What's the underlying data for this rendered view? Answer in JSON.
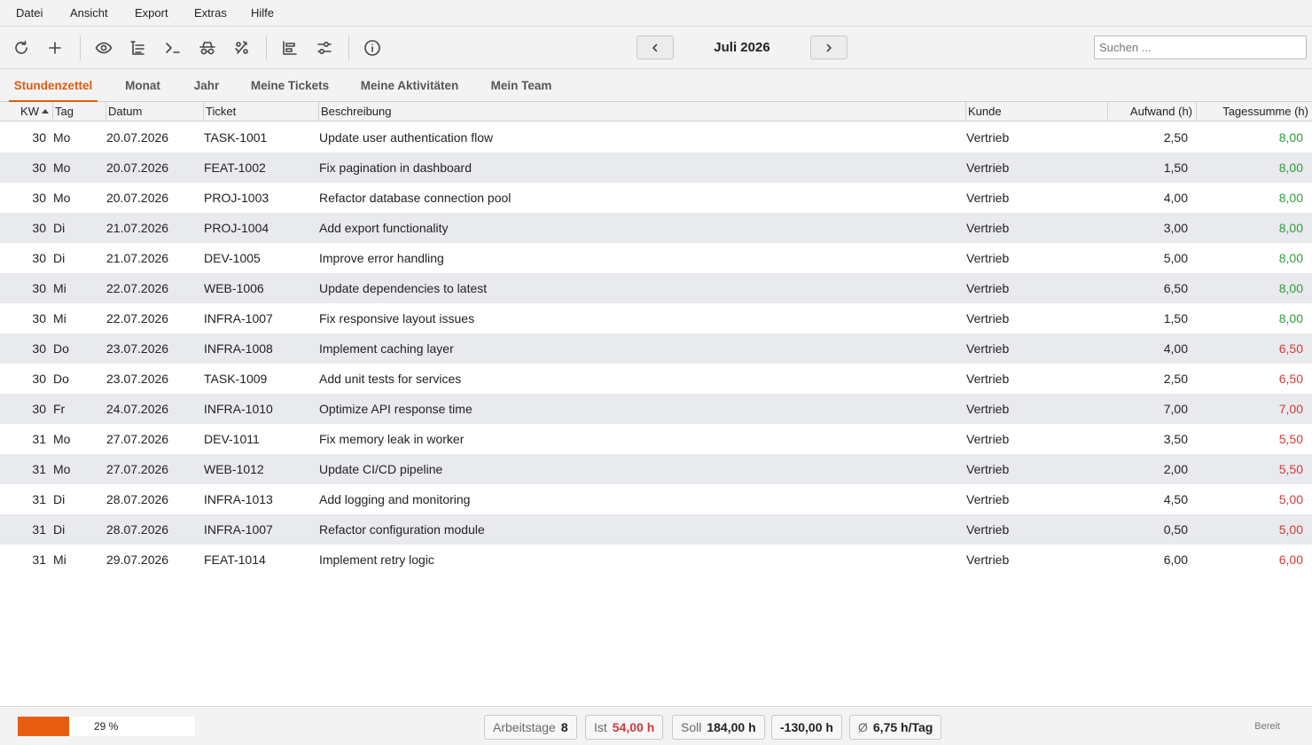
{
  "menu": [
    "Datei",
    "Ansicht",
    "Export",
    "Extras",
    "Hilfe"
  ],
  "toolbar": {
    "icons": [
      "refresh-icon",
      "plus-icon",
      "eye-icon",
      "list-icon",
      "terminal-icon",
      "incognito-icon",
      "percent-icon",
      "align-left-icon",
      "sliders-icon",
      "info-icon"
    ],
    "period": "Juli 2026",
    "search_placeholder": "Suchen ..."
  },
  "tabs": [
    {
      "label": "Stundenzettel",
      "active": true
    },
    {
      "label": "Monat",
      "active": false
    },
    {
      "label": "Jahr",
      "active": false
    },
    {
      "label": "Meine Tickets",
      "active": false
    },
    {
      "label": "Meine Aktivitäten",
      "active": false
    },
    {
      "label": "Mein Team",
      "active": false
    }
  ],
  "columns": [
    "KW",
    "Tag",
    "Datum",
    "Ticket",
    "Beschreibung",
    "Kunde",
    "Aufwand (h)",
    "Tagessumme (h)"
  ],
  "rows": [
    {
      "kw": "30",
      "tag": "Mo",
      "datum": "20.07.2026",
      "ticket": "TASK-1001",
      "beschreibung": "Update user authentication flow",
      "kunde": "Vertrieb",
      "aufwand": "2,50",
      "summe": "8,00",
      "ok": true
    },
    {
      "kw": "30",
      "tag": "Mo",
      "datum": "20.07.2026",
      "ticket": "FEAT-1002",
      "beschreibung": "Fix pagination in dashboard",
      "kunde": "Vertrieb",
      "aufwand": "1,50",
      "summe": "8,00",
      "ok": true
    },
    {
      "kw": "30",
      "tag": "Mo",
      "datum": "20.07.2026",
      "ticket": "PROJ-1003",
      "beschreibung": "Refactor database connection pool",
      "kunde": "Vertrieb",
      "aufwand": "4,00",
      "summe": "8,00",
      "ok": true
    },
    {
      "kw": "30",
      "tag": "Di",
      "datum": "21.07.2026",
      "ticket": "PROJ-1004",
      "beschreibung": "Add export functionality",
      "kunde": "Vertrieb",
      "aufwand": "3,00",
      "summe": "8,00",
      "ok": true
    },
    {
      "kw": "30",
      "tag": "Di",
      "datum": "21.07.2026",
      "ticket": "DEV-1005",
      "beschreibung": "Improve error handling",
      "kunde": "Vertrieb",
      "aufwand": "5,00",
      "summe": "8,00",
      "ok": true
    },
    {
      "kw": "30",
      "tag": "Mi",
      "datum": "22.07.2026",
      "ticket": "WEB-1006",
      "beschreibung": "Update dependencies to latest",
      "kunde": "Vertrieb",
      "aufwand": "6,50",
      "summe": "8,00",
      "ok": true
    },
    {
      "kw": "30",
      "tag": "Mi",
      "datum": "22.07.2026",
      "ticket": "INFRA-1007",
      "beschreibung": "Fix responsive layout issues",
      "kunde": "Vertrieb",
      "aufwand": "1,50",
      "summe": "8,00",
      "ok": true
    },
    {
      "kw": "30",
      "tag": "Do",
      "datum": "23.07.2026",
      "ticket": "INFRA-1008",
      "beschreibung": "Implement caching layer",
      "kunde": "Vertrieb",
      "aufwand": "4,00",
      "summe": "6,50",
      "ok": false
    },
    {
      "kw": "30",
      "tag": "Do",
      "datum": "23.07.2026",
      "ticket": "TASK-1009",
      "beschreibung": "Add unit tests for services",
      "kunde": "Vertrieb",
      "aufwand": "2,50",
      "summe": "6,50",
      "ok": false
    },
    {
      "kw": "30",
      "tag": "Fr",
      "datum": "24.07.2026",
      "ticket": "INFRA-1010",
      "beschreibung": "Optimize API response time",
      "kunde": "Vertrieb",
      "aufwand": "7,00",
      "summe": "7,00",
      "ok": false
    },
    {
      "kw": "31",
      "tag": "Mo",
      "datum": "27.07.2026",
      "ticket": "DEV-1011",
      "beschreibung": "Fix memory leak in worker",
      "kunde": "Vertrieb",
      "aufwand": "3,50",
      "summe": "5,50",
      "ok": false
    },
    {
      "kw": "31",
      "tag": "Mo",
      "datum": "27.07.2026",
      "ticket": "WEB-1012",
      "beschreibung": "Update CI/CD pipeline",
      "kunde": "Vertrieb",
      "aufwand": "2,00",
      "summe": "5,50",
      "ok": false
    },
    {
      "kw": "31",
      "tag": "Di",
      "datum": "28.07.2026",
      "ticket": "INFRA-1013",
      "beschreibung": "Add logging and monitoring",
      "kunde": "Vertrieb",
      "aufwand": "4,50",
      "summe": "5,00",
      "ok": false
    },
    {
      "kw": "31",
      "tag": "Di",
      "datum": "28.07.2026",
      "ticket": "INFRA-1007",
      "beschreibung": "Refactor configuration module",
      "kunde": "Vertrieb",
      "aufwand": "0,50",
      "summe": "5,00",
      "ok": false
    },
    {
      "kw": "31",
      "tag": "Mi",
      "datum": "29.07.2026",
      "ticket": "FEAT-1014",
      "beschreibung": "Implement retry logic",
      "kunde": "Vertrieb",
      "aufwand": "6,00",
      "summe": "6,00",
      "ok": false
    }
  ],
  "colors": {
    "accent": "#e05a10",
    "ok": "#2e9c3a",
    "warn": "#d23a3a"
  },
  "status": {
    "progress_percent": 29,
    "progress_label": "29 %",
    "arbeitstage_label": "Arbeitstage",
    "arbeitstage_value": "8",
    "ist_label": "Ist",
    "ist_value": "54,00 h",
    "soll_label": "Soll",
    "soll_value": "184,00 h",
    "diff_value": "-130,00 h",
    "avg_label": "Ø",
    "avg_value": "6,75 h/Tag",
    "ready": "Bereit"
  }
}
